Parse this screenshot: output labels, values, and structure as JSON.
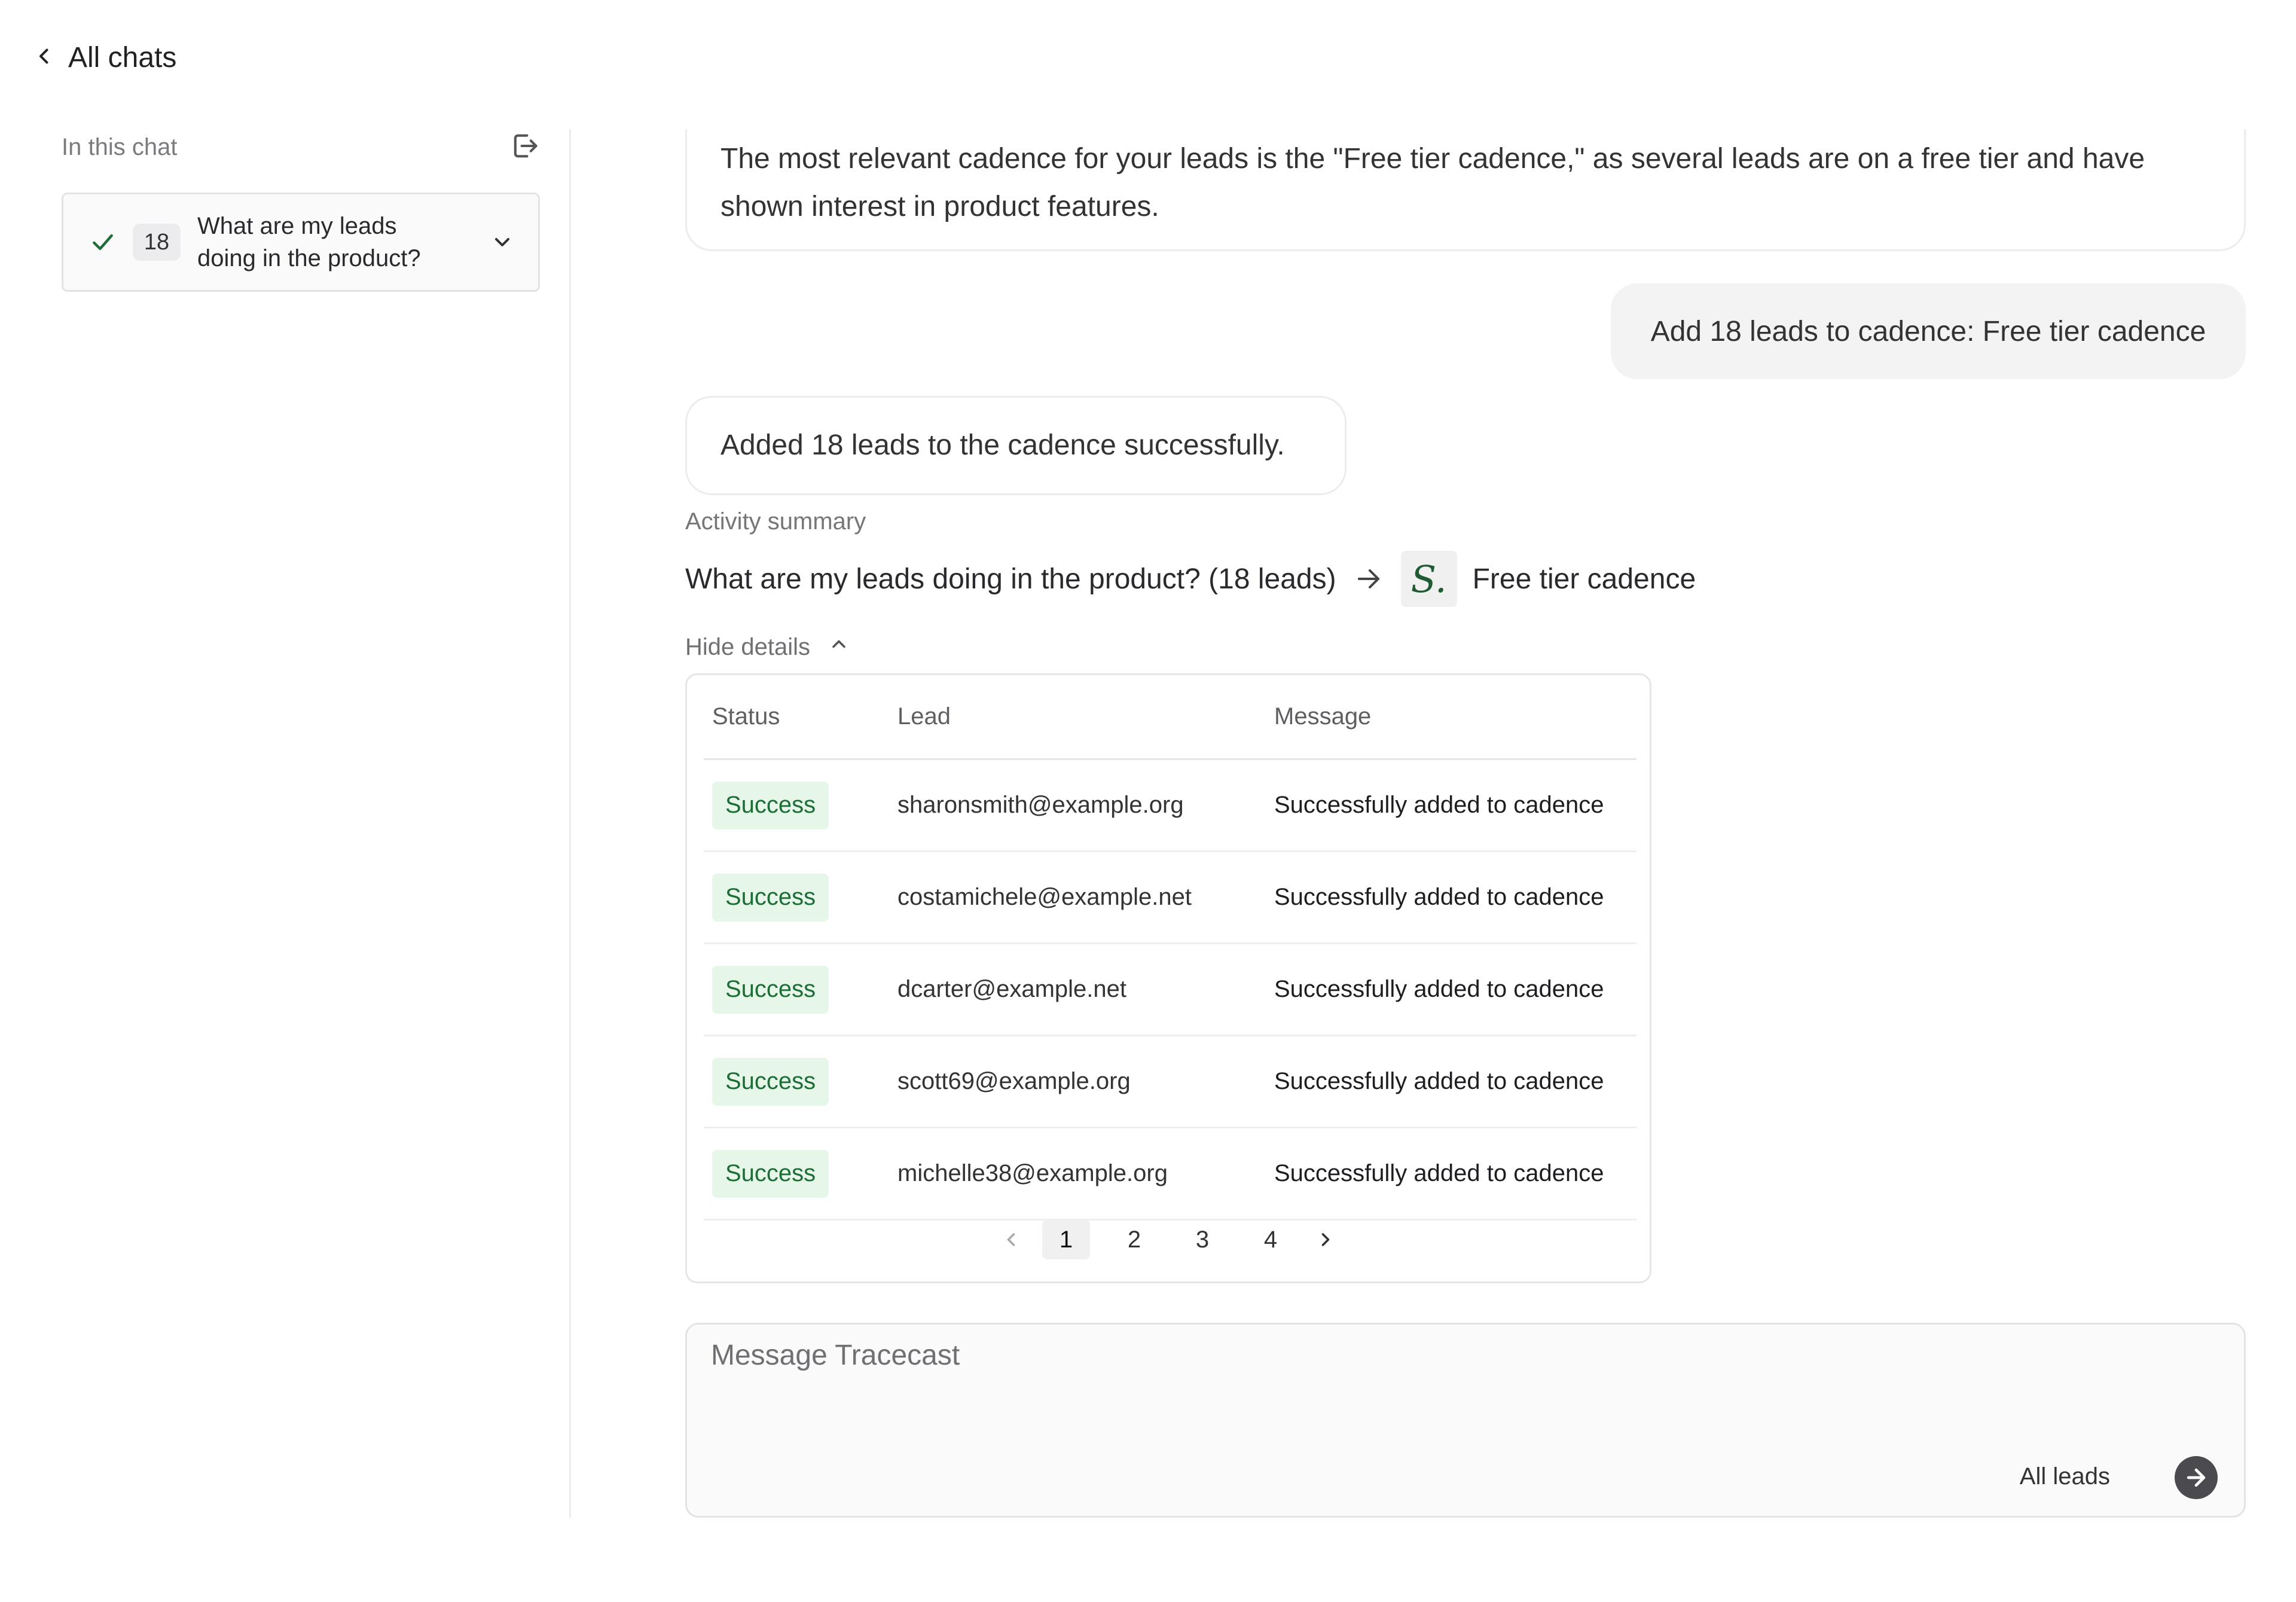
{
  "nav": {
    "back_label": "All chats"
  },
  "sidebar": {
    "heading": "In this chat",
    "chat_item": {
      "count": "18",
      "title": "What are my leads doing in the product?"
    }
  },
  "conversation": {
    "ai_message_1": "The most relevant cadence for your leads is the \"Free tier cadence,\" as several leads are on a free tier and have shown interest in product features.",
    "user_message": "Add 18 leads to cadence: Free tier cadence",
    "ai_message_2": "Added 18 leads to the cadence successfully."
  },
  "activity": {
    "label": "Activity summary",
    "source": "What are my leads doing in the product? (18 leads)",
    "target_logo_letter": "S.",
    "target": "Free tier cadence",
    "toggle_label": "Hide details"
  },
  "table": {
    "headers": {
      "status": "Status",
      "lead": "Lead",
      "message": "Message"
    },
    "rows": [
      {
        "status": "Success",
        "lead": "sharonsmith@example.org",
        "message": "Successfully added to cadence"
      },
      {
        "status": "Success",
        "lead": "costamichele@example.net",
        "message": "Successfully added to cadence"
      },
      {
        "status": "Success",
        "lead": "dcarter@example.net",
        "message": "Successfully added to cadence"
      },
      {
        "status": "Success",
        "lead": "scott69@example.org",
        "message": "Successfully added to cadence"
      },
      {
        "status": "Success",
        "lead": "michelle38@example.org",
        "message": "Successfully added to cadence"
      }
    ],
    "pagination": {
      "pages": [
        "1",
        "2",
        "3",
        "4"
      ],
      "current": "1"
    }
  },
  "composer": {
    "placeholder": "Message Tracecast",
    "scope": "All leads"
  },
  "colors": {
    "success_bg": "#e6f7ea",
    "success_text": "#1d6e36",
    "logo_green": "#1f5a32"
  }
}
